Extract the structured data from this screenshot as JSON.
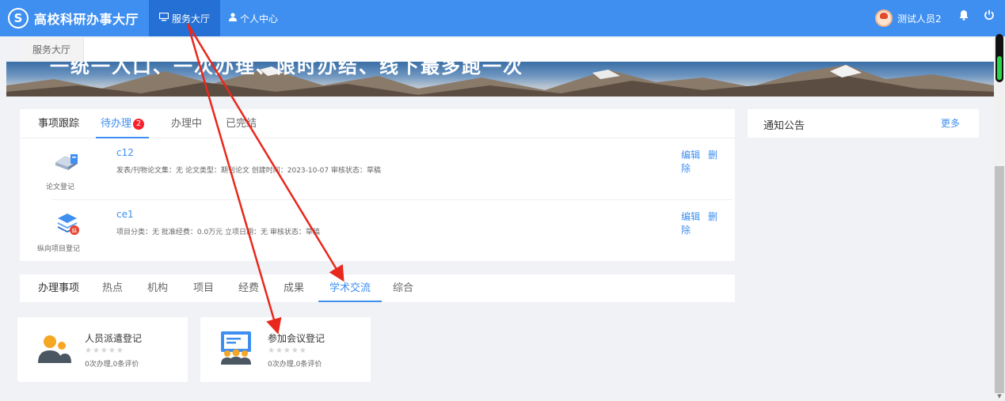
{
  "header": {
    "app_title": "高校科研办事大厅",
    "nav": [
      {
        "label": "服务大厅"
      },
      {
        "label": "个人中心"
      }
    ],
    "user_name": "测试人员2"
  },
  "breadcrumb": {
    "tab": "服务大厅"
  },
  "banner": {
    "slogan": "一统一入口、一次办理、限时办结、线下最多跑一次"
  },
  "tracking": {
    "title": "事项跟踪",
    "tabs": [
      {
        "label": "待办理",
        "badge": "2"
      },
      {
        "label": "办理中"
      },
      {
        "label": "已完结"
      }
    ],
    "items": [
      {
        "icon_label": "论文登记",
        "name": "c12",
        "meta": "发表/刊物论文集：无    论文类型：期刊论文    创建时间：2023-10-07    审核状态：草稿",
        "edit": "编辑",
        "delete": "删除"
      },
      {
        "icon_label": "纵向项目登记",
        "name": "ce1",
        "meta": "项目分类：无    批准经费：0.0万元    立项日期：无    审核状态：草稿",
        "edit": "编辑",
        "delete": "删除"
      }
    ]
  },
  "notice": {
    "title": "通知公告",
    "more": "更多"
  },
  "services": {
    "title": "办理事项",
    "tabs": [
      "热点",
      "机构",
      "项目",
      "经费",
      "成果",
      "学术交流",
      "综合"
    ],
    "active_tab": "学术交流",
    "cards": [
      {
        "title": "人员派遣登记",
        "stars": "★★★★★",
        "stats": "0次办理,0条评价"
      },
      {
        "title": "参加会议登记",
        "stars": "★★★★★",
        "stats": "0次办理,0条评价"
      }
    ]
  },
  "colors": {
    "primary": "#3f8ff0",
    "nav_active": "#2470d4",
    "badge": "#f5222d",
    "arrow": "#e8281c"
  }
}
